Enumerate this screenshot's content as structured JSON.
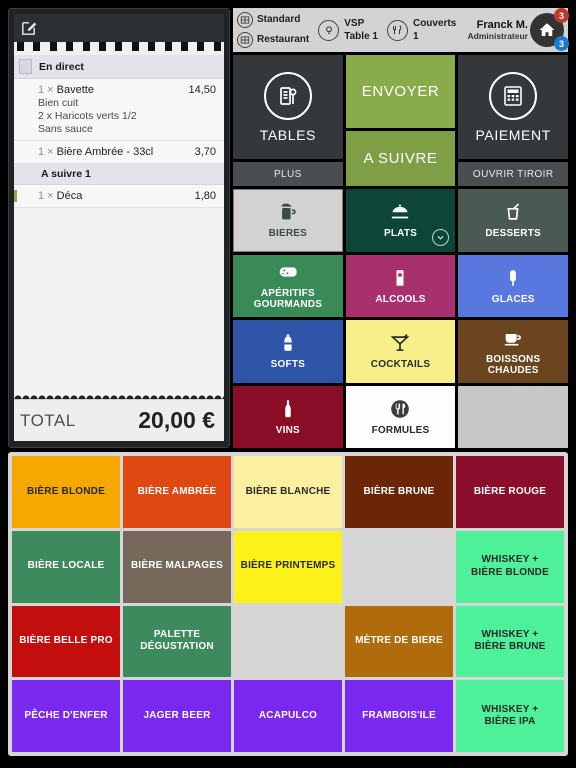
{
  "header": {
    "mode_primary": "Standard",
    "mode_secondary": "Restaurant",
    "location_label": "VSP",
    "location_value": "Table 1",
    "covers_label": "Couverts",
    "covers_value": "1",
    "user_name": "Franck M.",
    "user_role": "Administrateur",
    "home_icon": "home-icon",
    "badge_red": "3",
    "badge_blue": "3",
    "icons": {
      "mode": "grid-icon",
      "location": "location-pin-icon",
      "covers": "cutlery-icon"
    }
  },
  "receipt": {
    "edit_icon": "edit-pencil-icon",
    "sections": [
      {
        "title": "En direct",
        "has_icon": true,
        "items": [
          {
            "qty": "1",
            "sep": "×",
            "name": "Bavette",
            "price": "14,50",
            "accent": "none",
            "options": [
              "Bien cuit",
              "2 x Haricots verts 1/2",
              "Sans sauce"
            ]
          },
          {
            "qty": "1",
            "sep": "×",
            "name": "Bière Ambrée - 33cl",
            "price": "3,70",
            "accent": "none",
            "options": []
          }
        ]
      },
      {
        "title": "A suivre 1",
        "has_icon": false,
        "items": [
          {
            "qty": "1",
            "sep": "×",
            "name": "Déca",
            "price": "1,80",
            "accent": "green",
            "options": []
          }
        ]
      }
    ],
    "total_label": "TOTAL",
    "total_value": "20,00 €"
  },
  "actions": {
    "tables_label": "TABLES",
    "tables_icon": "tables-icon",
    "plus_label": "PLUS",
    "send_label": "ENVOYER",
    "follow_label": "A SUIVRE",
    "payment_label": "PAIEMENT",
    "payment_icon": "calculator-icon",
    "drawer_label": "OUVRIR TIROIR"
  },
  "categories": [
    {
      "label": "BIERES",
      "icon": "beer-mug-icon",
      "bg": "#d2d2d2",
      "fg": "#3a4a4a",
      "selected": true,
      "chevron": false
    },
    {
      "label": "PLATS",
      "icon": "food-cloche-icon",
      "bg": "#0d4636",
      "fg": "#ffffff",
      "selected": false,
      "chevron": true
    },
    {
      "label": "DESSERTS",
      "icon": "dessert-cup-icon",
      "bg": "#4a5a52",
      "fg": "#ffffff",
      "selected": false,
      "chevron": false
    },
    {
      "label": "APÉRITIFS GOURMANDS",
      "icon": "sausage-icon",
      "bg": "#3a8a57",
      "fg": "#ffffff",
      "selected": false,
      "chevron": false
    },
    {
      "label": "ALCOOLS",
      "icon": "glass-icon",
      "bg": "#a8306d",
      "fg": "#ffffff",
      "selected": false,
      "chevron": false
    },
    {
      "label": "GLACES",
      "icon": "ice-cream-bar-icon",
      "bg": "#5878e0",
      "fg": "#ffffff",
      "selected": false,
      "chevron": false
    },
    {
      "label": "SOFTS",
      "icon": "soda-bottle-icon",
      "bg": "#2e54a8",
      "fg": "#ffffff",
      "selected": false,
      "chevron": false
    },
    {
      "label": "COCKTAILS",
      "icon": "cocktail-icon",
      "bg": "#f7f08a",
      "fg": "#2a2a2a",
      "selected": false,
      "chevron": false
    },
    {
      "label": "BOISSONS CHAUDES",
      "icon": "coffee-cup-icon",
      "bg": "#6b4420",
      "fg": "#ffffff",
      "selected": false,
      "chevron": false
    },
    {
      "label": "VINS",
      "icon": "wine-bottle-icon",
      "bg": "#8a0e28",
      "fg": "#ffffff",
      "selected": false,
      "chevron": false
    },
    {
      "label": "FORMULES",
      "icon": "cutlery-circle-icon",
      "bg": "#fdfdfd",
      "fg": "#2a2a2a",
      "selected": false,
      "chevron": false
    },
    {
      "label": "",
      "icon": "",
      "bg": "#c8c8c8",
      "fg": "#2a2a2a",
      "selected": false,
      "chevron": false
    }
  ],
  "products": [
    {
      "label": "BIÈRE BLONDE",
      "bg": "#f5a800",
      "fg": "#2a2a2a",
      "empty": false
    },
    {
      "label": "BIÈRE AMBRÉE",
      "bg": "#e04812",
      "fg": "#ffffff",
      "empty": false
    },
    {
      "label": "BIÈRE BLANCHE",
      "bg": "#faf0a0",
      "fg": "#2a2a2a",
      "empty": false
    },
    {
      "label": "BIÈRE BRUNE",
      "bg": "#6b2507",
      "fg": "#ffffff",
      "empty": false
    },
    {
      "label": "BIÈRE ROUGE",
      "bg": "#8a0e2c",
      "fg": "#ffffff",
      "empty": false
    },
    {
      "label": "BIÈRE LOCALE",
      "bg": "#3d8a5e",
      "fg": "#ffffff",
      "empty": false
    },
    {
      "label": "BIÈRE MALPAGES",
      "bg": "#76685b",
      "fg": "#ffffff",
      "empty": false
    },
    {
      "label": "BIÈRE PRINTEMPS",
      "bg": "#fcf219",
      "fg": "#2a2a2a",
      "empty": false
    },
    {
      "label": "",
      "bg": "#dadada",
      "fg": "#2a2a2a",
      "empty": true
    },
    {
      "label": "WHISKEY +\nBIÈRE BLONDE",
      "bg": "#4ef09a",
      "fg": "#2a2a2a",
      "empty": false
    },
    {
      "label": "BIÈRE BELLE PRO",
      "bg": "#c40d0d",
      "fg": "#ffffff",
      "empty": false
    },
    {
      "label": "PALETTE\nDÉGUSTATION",
      "bg": "#3d8a5e",
      "fg": "#ffffff",
      "empty": false
    },
    {
      "label": "",
      "bg": "#dadada",
      "fg": "#2a2a2a",
      "empty": true
    },
    {
      "label": "MÈTRE DE BIERE",
      "bg": "#b06c0c",
      "fg": "#ffffff",
      "empty": false
    },
    {
      "label": "WHISKEY +\nBIÈRE BRUNE",
      "bg": "#4ef09a",
      "fg": "#2a2a2a",
      "empty": false
    },
    {
      "label": "PÊCHE D'ENFER",
      "bg": "#7a28f0",
      "fg": "#ffffff",
      "empty": false
    },
    {
      "label": "JAGER BEER",
      "bg": "#7a28f0",
      "fg": "#ffffff",
      "empty": false
    },
    {
      "label": "ACAPULCO",
      "bg": "#7a28f0",
      "fg": "#ffffff",
      "empty": false
    },
    {
      "label": "FRAMBOIS'ILE",
      "bg": "#7a28f0",
      "fg": "#ffffff",
      "empty": false
    },
    {
      "label": "WHISKEY +\nBIÈRE IPA",
      "bg": "#4ef09a",
      "fg": "#2a2a2a",
      "empty": false
    }
  ]
}
